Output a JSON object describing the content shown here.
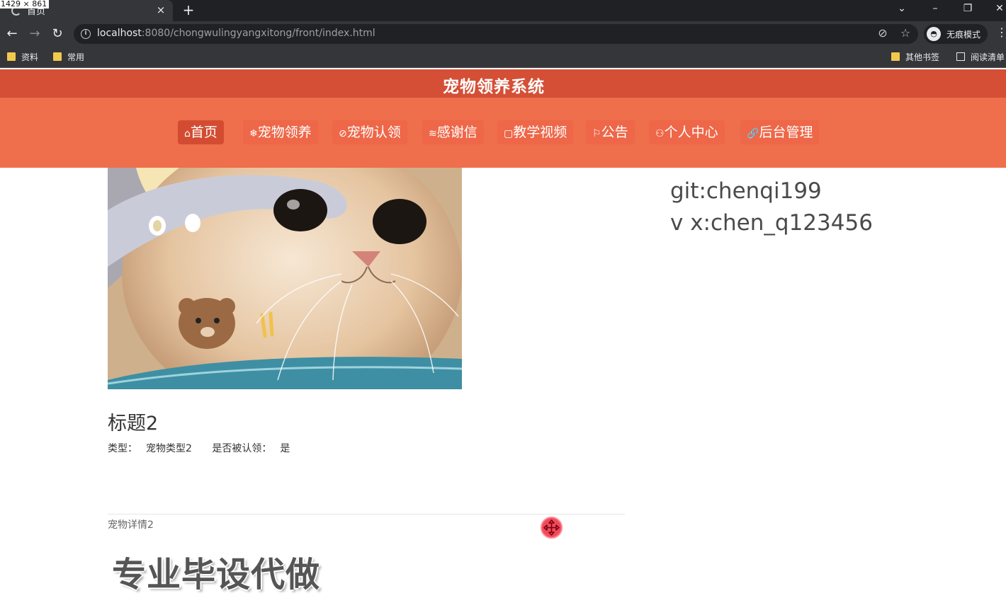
{
  "browser": {
    "dimensions_label": "1429 × 861",
    "tab_title": "首页",
    "tab_close": "×",
    "new_tab": "+",
    "url_host": "localhost",
    "url_path": ":8080/chongwulingyangxitong/front/index.html",
    "incognito_label": "无痕模式",
    "bookmarks": [
      "资料",
      "常用"
    ],
    "bookmarks_right": [
      "其他书签",
      "阅读清单"
    ]
  },
  "site": {
    "title": "宠物领养系统",
    "nav": [
      {
        "icon": "⌂",
        "label": "首页",
        "active": true
      },
      {
        "icon": "❄",
        "label": "宠物领养"
      },
      {
        "icon": "⊘",
        "label": "宠物认领"
      },
      {
        "icon": "≋",
        "label": "感谢信"
      },
      {
        "icon": "▢",
        "label": "教学视频"
      },
      {
        "icon": "⚐",
        "label": "公告"
      },
      {
        "icon": "⚇",
        "label": "个人中心"
      },
      {
        "icon": "🔗",
        "label": "后台管理"
      }
    ]
  },
  "content": {
    "contact_line1": "git:chenqi199",
    "contact_line2": "v x:chen_q123456",
    "pet_title": "标题2",
    "type_label": "类型：",
    "type_value": "宠物类型2",
    "claimed_label": "是否被认领：",
    "claimed_value": "是",
    "detail": "宠物详情2",
    "promo": "专业毕设代做"
  },
  "colors": {
    "header": "#d44f36",
    "nav": "#ef6e4c",
    "nav_active": "#d34c32"
  }
}
